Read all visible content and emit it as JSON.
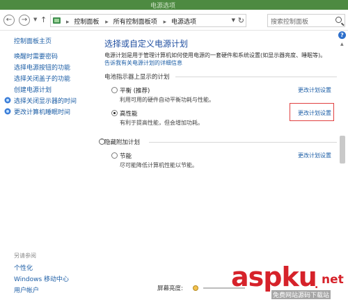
{
  "window": {
    "title": "电源选项"
  },
  "address": {
    "crumbs": [
      "控制面板",
      "所有控制面板项",
      "电源选项"
    ],
    "search_placeholder": "搜索控制面板"
  },
  "leftnav": {
    "home": "控制面板主页",
    "items": [
      "唤醒时需要密码",
      "选择电源按钮的功能",
      "选择关闭盖子的功能",
      "创建电源计划",
      "选择关闭显示器的时间",
      "更改计算机睡眠时间"
    ],
    "see_also_label": "另请参阅",
    "see_also": [
      "个性化",
      "Windows 移动中心",
      "用户帐户"
    ]
  },
  "main": {
    "heading": "选择或自定义电源计划",
    "description": "电源计划是用于管理计算机如何使用电源的一套硬件和系统设置(如显示器亮度、睡眠等)。",
    "description_link": "告诉我有关电源计划的详细信息",
    "section_battery": "电池指示器上显示的计划",
    "section_hidden": "隐藏附加计划",
    "change_link": "更改计划设置",
    "plans": [
      {
        "name": "平衡 (推荐)",
        "desc": "利用可用的硬件自动平衡功耗与性能。",
        "selected": false
      },
      {
        "name": "高性能",
        "desc": "有利于提高性能，但会增加功耗。",
        "selected": true
      },
      {
        "name": "节能",
        "desc": "尽可能降低计算机性能以节能。",
        "selected": false
      }
    ]
  },
  "status": {
    "brightness_label": "屏幕亮度:"
  },
  "watermark": {
    "brand_main": "asp",
    "brand_accent": "ku",
    "brand_dot": ".",
    "brand_tld": "net",
    "tagline": "免费网站源码下载站"
  },
  "colors": {
    "titlebar": "#4d8a41",
    "link": "#1c5ea6",
    "heading": "#1f4ea0",
    "highlight": "#e04040",
    "brand": "#d6222a"
  }
}
